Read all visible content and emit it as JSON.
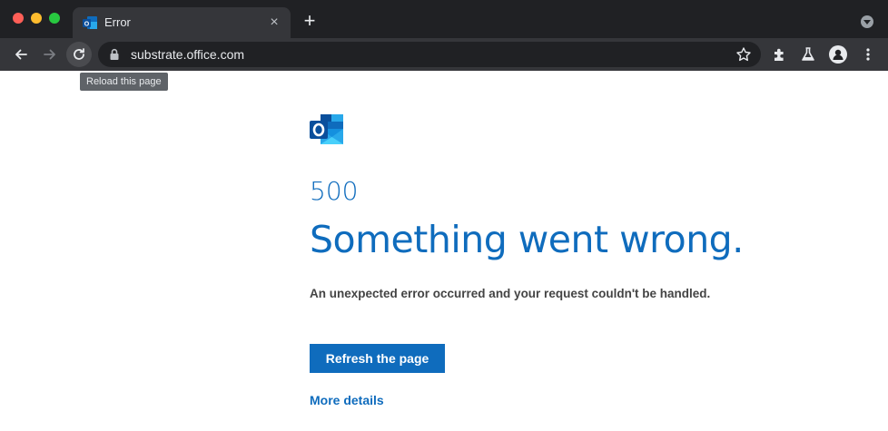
{
  "browser": {
    "tab": {
      "title": "Error",
      "favicon": "outlook-icon",
      "close_label": "×"
    },
    "new_tab_label": "+",
    "address": {
      "url": "substrate.office.com"
    },
    "tooltip": "Reload this page"
  },
  "page": {
    "error_code": "500",
    "title": "Something went wrong.",
    "message": "An unexpected error occurred and your request couldn't be handled.",
    "refresh_label": "Refresh the page",
    "more_details_label": "More details"
  },
  "colors": {
    "accent": "#0f6cbd",
    "chrome_dark": "#202124",
    "chrome_toolbar": "#35363a"
  }
}
